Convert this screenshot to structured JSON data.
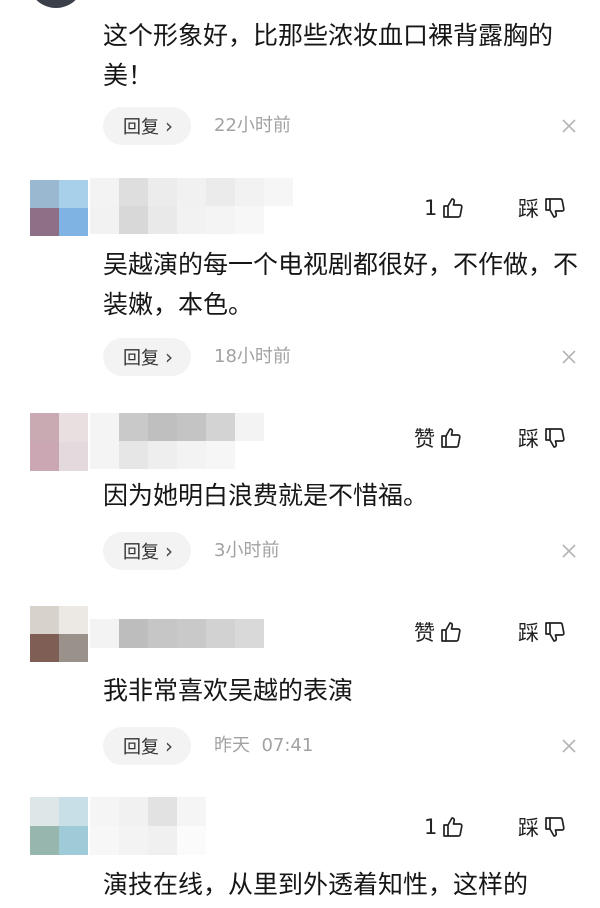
{
  "comments": [
    {
      "text": "这个形象好，比那些浓妆血口裸背露胸的美！",
      "reply_label": "回复",
      "time": "22小时前"
    },
    {
      "like_label": "1",
      "dislike_label": "踩",
      "text": "吴越演的每一个电视剧都很好，不作做，不装嫩，本色。",
      "reply_label": "回复",
      "time": "18小时前"
    },
    {
      "like_label": "赞",
      "dislike_label": "踩",
      "text": "因为她明白浪费就是不惜福。",
      "reply_label": "回复",
      "time": "3小时前"
    },
    {
      "like_label": "赞",
      "dislike_label": "踩",
      "text": "我非常喜欢吴越的表演",
      "reply_label": "回复",
      "time": "昨天  07:41"
    },
    {
      "like_label": "1",
      "dislike_label": "踩",
      "text": "演技在线，从里到外透着知性，这样的"
    }
  ],
  "icons": {
    "reply_chevron": "chevron-right-icon",
    "like": "thumb-up-icon",
    "dislike": "thumb-down-icon",
    "close": "close-icon"
  },
  "colors": {
    "background": "#ffffff",
    "text": "#161616",
    "meta": "#a2a2a2",
    "reply_bg": "#f3f3f3"
  }
}
